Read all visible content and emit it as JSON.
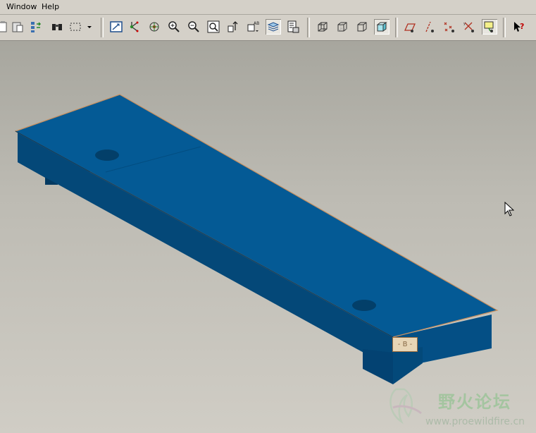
{
  "menubar": {
    "items": [
      "Window",
      "Help"
    ]
  },
  "toolbar": {
    "groups": [
      {
        "name": "file",
        "icons": [
          "paste-icon",
          "paste-special-icon",
          "regenerate-icon",
          "find-icon",
          "select-box-icon",
          "dropdown-arrow-icon"
        ]
      },
      {
        "name": "view",
        "icons": [
          "repaint-icon",
          "spin-center-icon",
          "orient-mode-icon",
          "zoom-in-icon",
          "zoom-out-icon",
          "refit-icon",
          "reorient-icon",
          "saved-views-icon",
          "layers-icon",
          "model-tree-icon"
        ]
      },
      {
        "name": "display-style",
        "icons": [
          "wireframe-icon",
          "hidden-line-icon",
          "no-hidden-icon",
          "shading-icon"
        ]
      },
      {
        "name": "datum-display",
        "icons": [
          "datum-planes-icon",
          "datum-axes-icon",
          "datum-points-icon",
          "coord-sys-icon",
          "annotations-icon"
        ]
      },
      {
        "name": "help",
        "icons": [
          "context-help-icon"
        ]
      }
    ],
    "pressed": [
      "layers-icon",
      "shading-icon",
      "annotations-icon"
    ]
  },
  "viewport": {
    "datum_label": "- B -",
    "colors": {
      "model_top": "#045a95",
      "model_side": "#044b7c",
      "model_dark": "#033e66",
      "edge_highlight": "#c89060"
    }
  },
  "watermark": {
    "title": "野火论坛",
    "url": "www.proewildfire.cn"
  }
}
